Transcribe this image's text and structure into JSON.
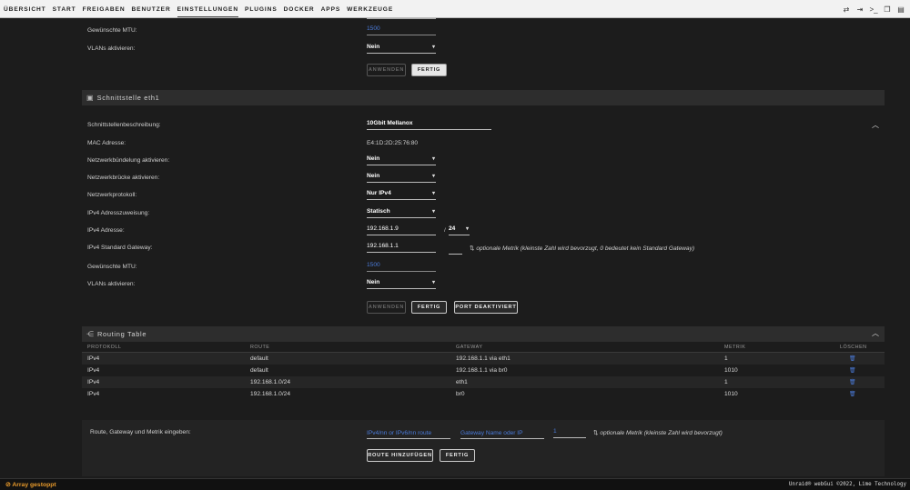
{
  "nav": {
    "items": [
      "ÜBERSICHT",
      "START",
      "FREIGABEN",
      "BENUTZER",
      "EINSTELLUNGEN",
      "PLUGINS",
      "DOCKER",
      "APPS",
      "WERKZEUGE"
    ],
    "active_index": 4,
    "icons": [
      "arrows-icon",
      "logout-icon",
      "terminal-icon",
      "window-icon",
      "log-icon"
    ]
  },
  "top_section": {
    "mtu_label": "Gewünschte MTU:",
    "mtu_value": "1500",
    "vlans_label": "VLANs aktivieren:",
    "vlans_value": "Nein",
    "apply_btn": "ANWENDEN",
    "done_btn": "FERTIG"
  },
  "eth1": {
    "title": "Schnittstelle eth1",
    "desc_label": "Schnittstellenbeschreibung:",
    "desc_value": "10Gbit Mellanox",
    "mac_label": "MAC Adresse:",
    "mac_value": "E4:1D:2D:25:76:80",
    "bonding_label": "Netzwerkbündelung aktivieren:",
    "bonding_value": "Nein",
    "bridge_label": "Netzwerkbrücke aktivieren:",
    "bridge_value": "Nein",
    "protocol_label": "Netzwerkprotokoll:",
    "protocol_value": "Nur IPv4",
    "assign_label": "IPv4 Adresszuweisung:",
    "assign_value": "Statisch",
    "ipv4_label": "IPv4 Adresse:",
    "ipv4_value": "192.168.1.9",
    "slash": "/",
    "prefix_value": "24",
    "gw_label": "IPv4 Standard Gateway:",
    "gw_value": "192.168.1.1",
    "gw_note": "optionale Metrik (kleinste Zahl wird bevorzugt, 0 bedeutet kein Standard Gateway)",
    "mtu_label": "Gewünschte MTU:",
    "mtu_value": "1500",
    "vlans_label": "VLANs aktivieren:",
    "vlans_value": "Nein",
    "apply_btn": "ANWENDEN",
    "done_btn": "FERTIG",
    "port_off_btn": "PORT DEAKTIVIERT"
  },
  "routing": {
    "title": "Routing Table",
    "columns": [
      "PROTOKOLL",
      "ROUTE",
      "GATEWAY",
      "METRIK",
      "LÖSCHEN"
    ],
    "rows": [
      [
        "IPv4",
        "default",
        "192.168.1.1 via eth1",
        "1"
      ],
      [
        "IPv4",
        "default",
        "192.168.1.1 via br0",
        "1010"
      ],
      [
        "IPv4",
        "192.168.1.0/24",
        "eth1",
        "1"
      ],
      [
        "IPv4",
        "192.168.1.0/24",
        "br0",
        "1010"
      ]
    ]
  },
  "addroute": {
    "label": "Route, Gateway und Metrik eingeben:",
    "route_placeholder": "IPv4/nn or IPv6/nn route",
    "gateway_placeholder": "Gateway Name oder IP",
    "metric_value": "1",
    "note": "optionale Metrik (kleinste Zahl wird bevorzugt)",
    "add_btn": "ROUTE HINZUFÜGEN",
    "done_btn": "FERTIG"
  },
  "footer": {
    "status": "Array gestoppt",
    "copyright": "Unraid® webGui ©2022, Lime Technology"
  },
  "colors": {
    "accent": "#4a7ad8",
    "status": "#e89a2b"
  }
}
